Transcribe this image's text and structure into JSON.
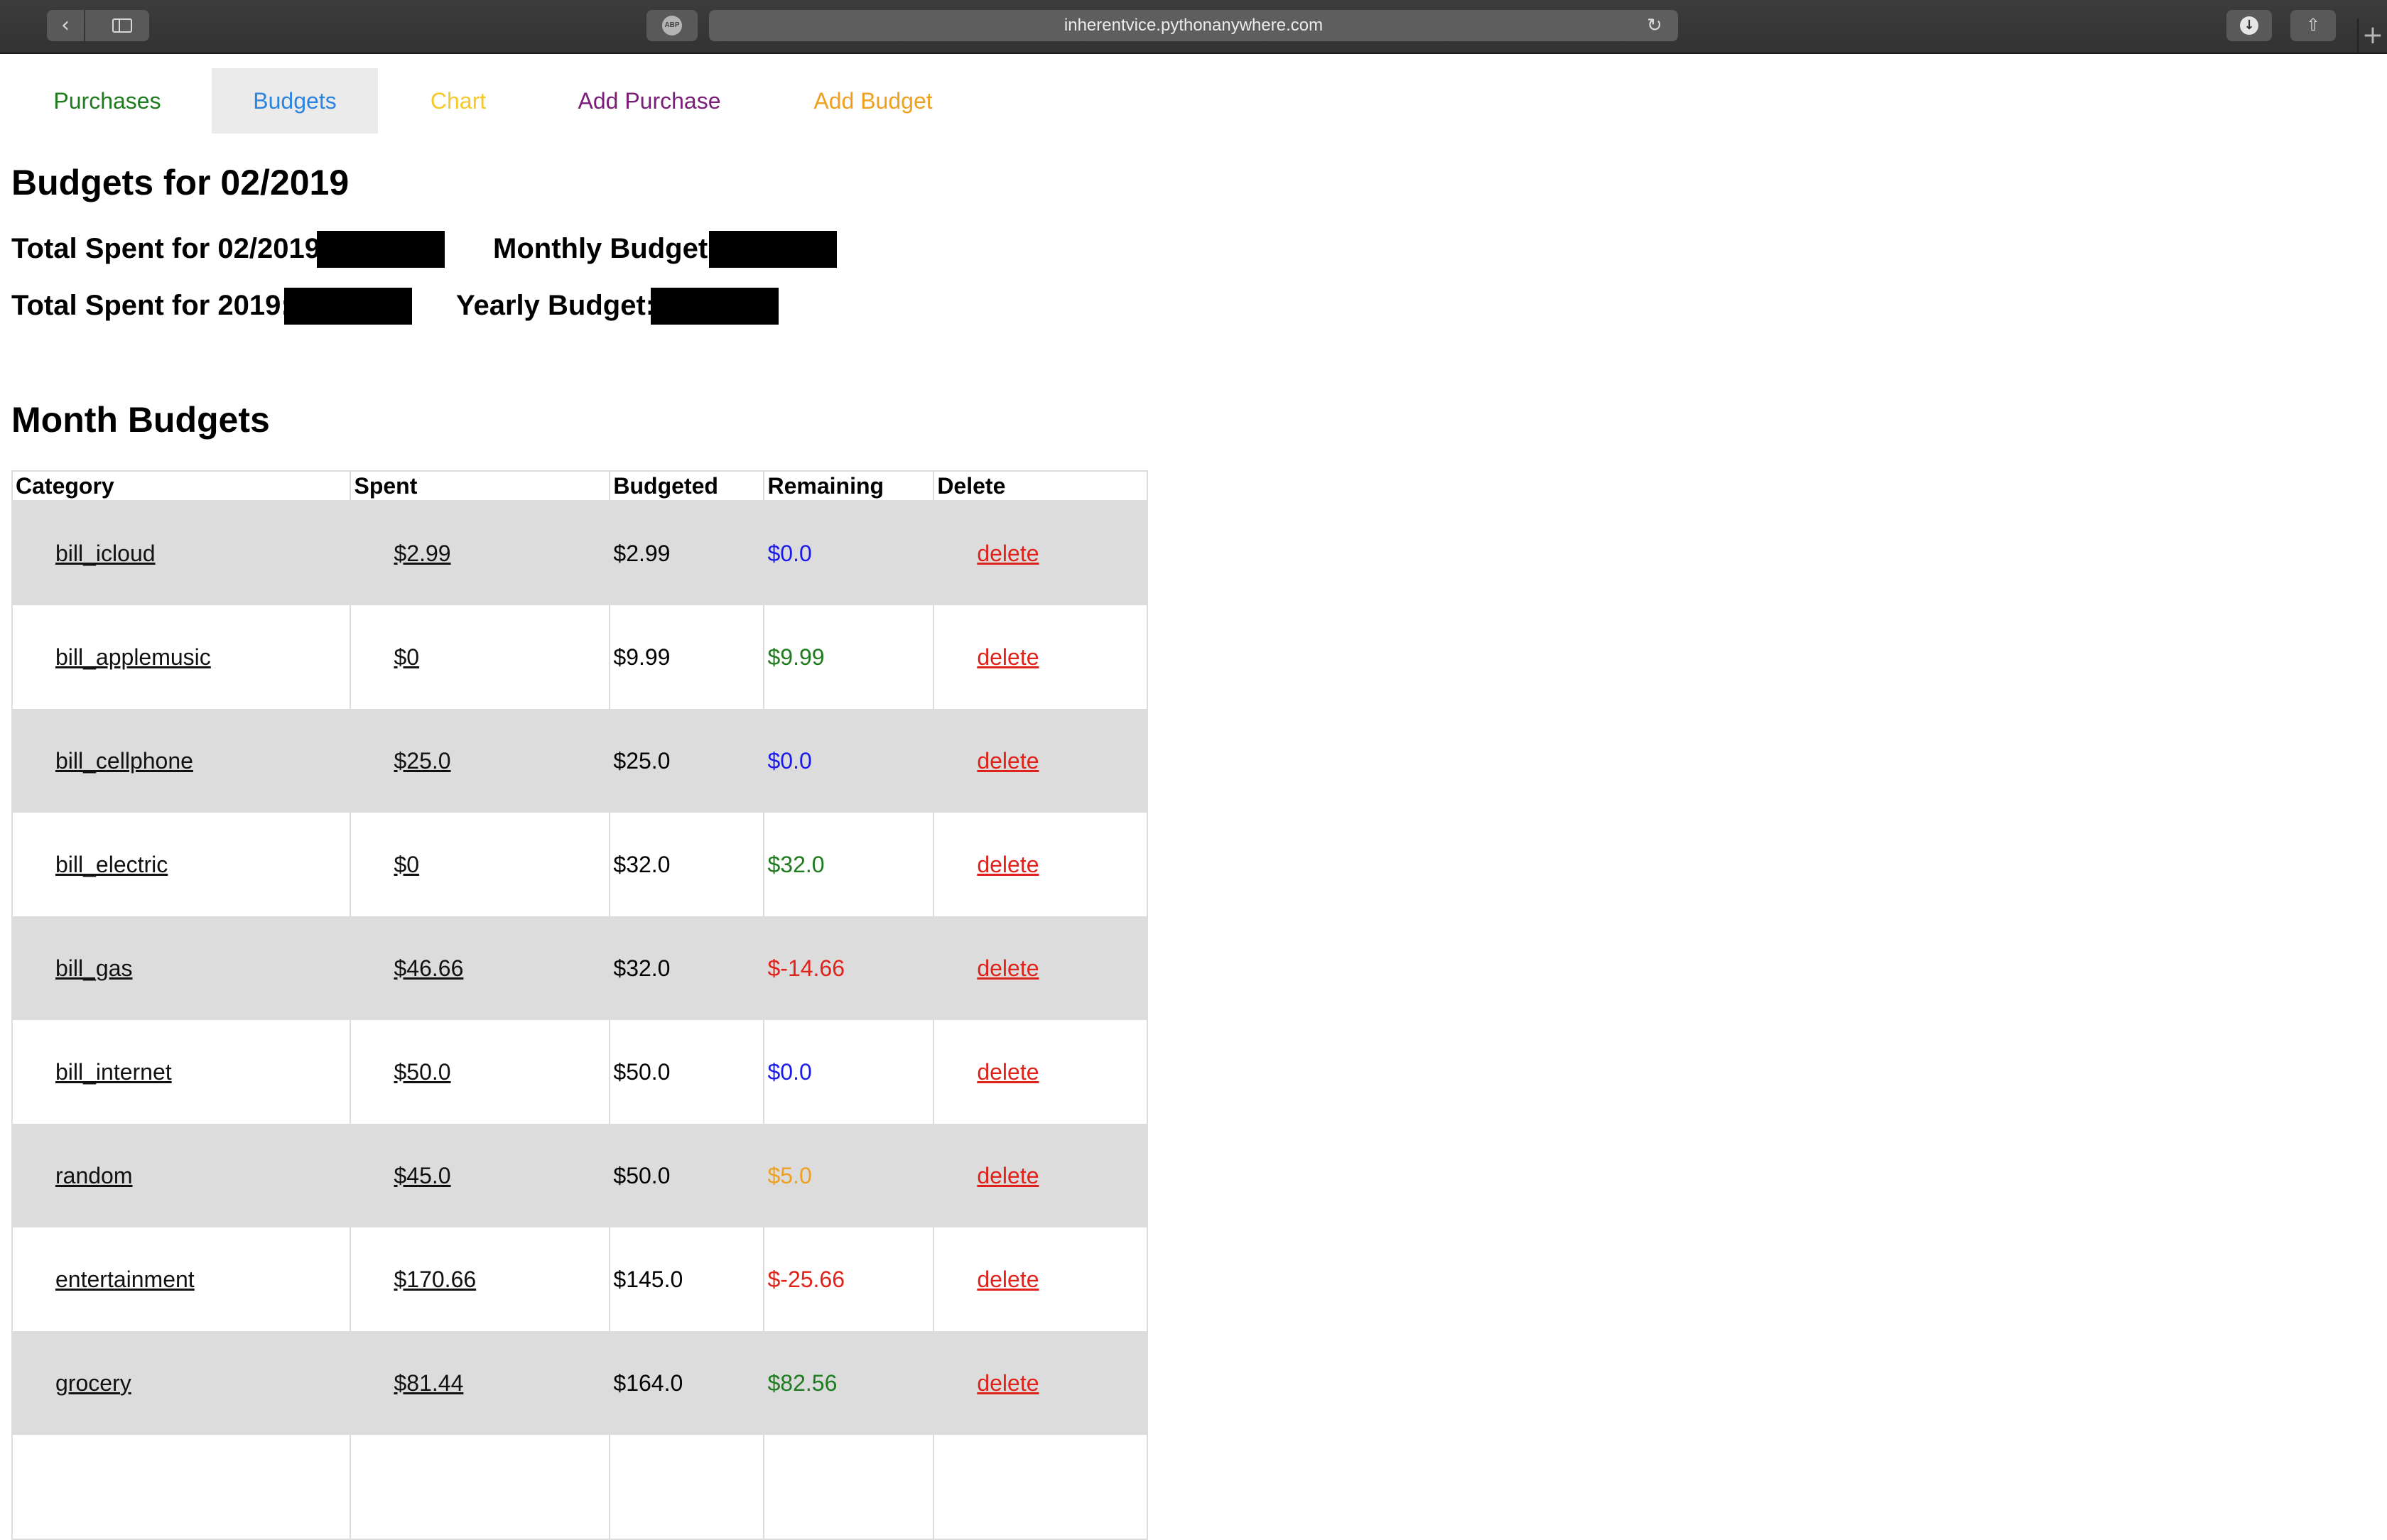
{
  "browser": {
    "url": "inherentvice.pythonanywhere.com",
    "abp_label": "ABP"
  },
  "nav": {
    "purchases": "Purchases",
    "budgets": "Budgets",
    "chart": "Chart",
    "add_purchase": "Add Purchase",
    "add_budget": "Add Budget",
    "active": "Budgets"
  },
  "header": {
    "title": "Budgets for 02/2019",
    "total_spent_month_label": "Total Spent for 02/2019:",
    "monthly_budget_label": "Monthly Budget:",
    "total_spent_year_label": "Total Spent for 2019:",
    "yearly_budget_label": "Yearly Budget:"
  },
  "section": {
    "title": "Month Budgets"
  },
  "table": {
    "columns": [
      "Category",
      "Spent",
      "Budgeted",
      "Remaining",
      "Delete"
    ],
    "rows": [
      {
        "category": "bill_icloud",
        "spent": "$2.99",
        "budgeted": "$2.99",
        "remaining": "$0.0",
        "remaining_status": "zero",
        "delete": "delete"
      },
      {
        "category": "bill_applemusic",
        "spent": "$0",
        "budgeted": "$9.99",
        "remaining": "$9.99",
        "remaining_status": "under",
        "delete": "delete"
      },
      {
        "category": "bill_cellphone",
        "spent": "$25.0",
        "budgeted": "$25.0",
        "remaining": "$0.0",
        "remaining_status": "zero",
        "delete": "delete"
      },
      {
        "category": "bill_electric",
        "spent": "$0",
        "budgeted": "$32.0",
        "remaining": "$32.0",
        "remaining_status": "under",
        "delete": "delete"
      },
      {
        "category": "bill_gas",
        "spent": "$46.66",
        "budgeted": "$32.0",
        "remaining": "$-14.66",
        "remaining_status": "over",
        "delete": "delete"
      },
      {
        "category": "bill_internet",
        "spent": "$50.0",
        "budgeted": "$50.0",
        "remaining": "$0.0",
        "remaining_status": "zero",
        "delete": "delete"
      },
      {
        "category": "random",
        "spent": "$45.0",
        "budgeted": "$50.0",
        "remaining": "$5.0",
        "remaining_status": "warning",
        "delete": "delete"
      },
      {
        "category": "entertainment",
        "spent": "$170.66",
        "budgeted": "$145.0",
        "remaining": "$-25.66",
        "remaining_status": "over",
        "delete": "delete"
      },
      {
        "category": "grocery",
        "spent": "$81.44",
        "budgeted": "$164.0",
        "remaining": "$82.56",
        "remaining_status": "under",
        "delete": "delete"
      },
      {
        "category": "",
        "spent": "",
        "budgeted": "",
        "remaining": "",
        "remaining_status": "",
        "delete": ""
      }
    ]
  },
  "colors": {
    "zero": "#1a1aeb",
    "under": "#1e7c1e",
    "over": "#e0221a",
    "warning": "#f0a020"
  }
}
